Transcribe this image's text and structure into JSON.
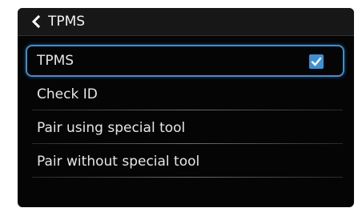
{
  "header": {
    "back_icon": "chevron-left-icon",
    "title": "TPMS"
  },
  "menu": {
    "items": [
      {
        "label": "TPMS",
        "selected": true,
        "checked": true
      },
      {
        "label": "Check ID"
      },
      {
        "label": "Pair using special tool"
      },
      {
        "label": "Pair without special tool"
      }
    ]
  },
  "colors": {
    "background": "#050505",
    "header": "#171717",
    "accent": "#3c8fd0",
    "checkbox": "#3d8fd6",
    "text": "#e6e6e6"
  }
}
